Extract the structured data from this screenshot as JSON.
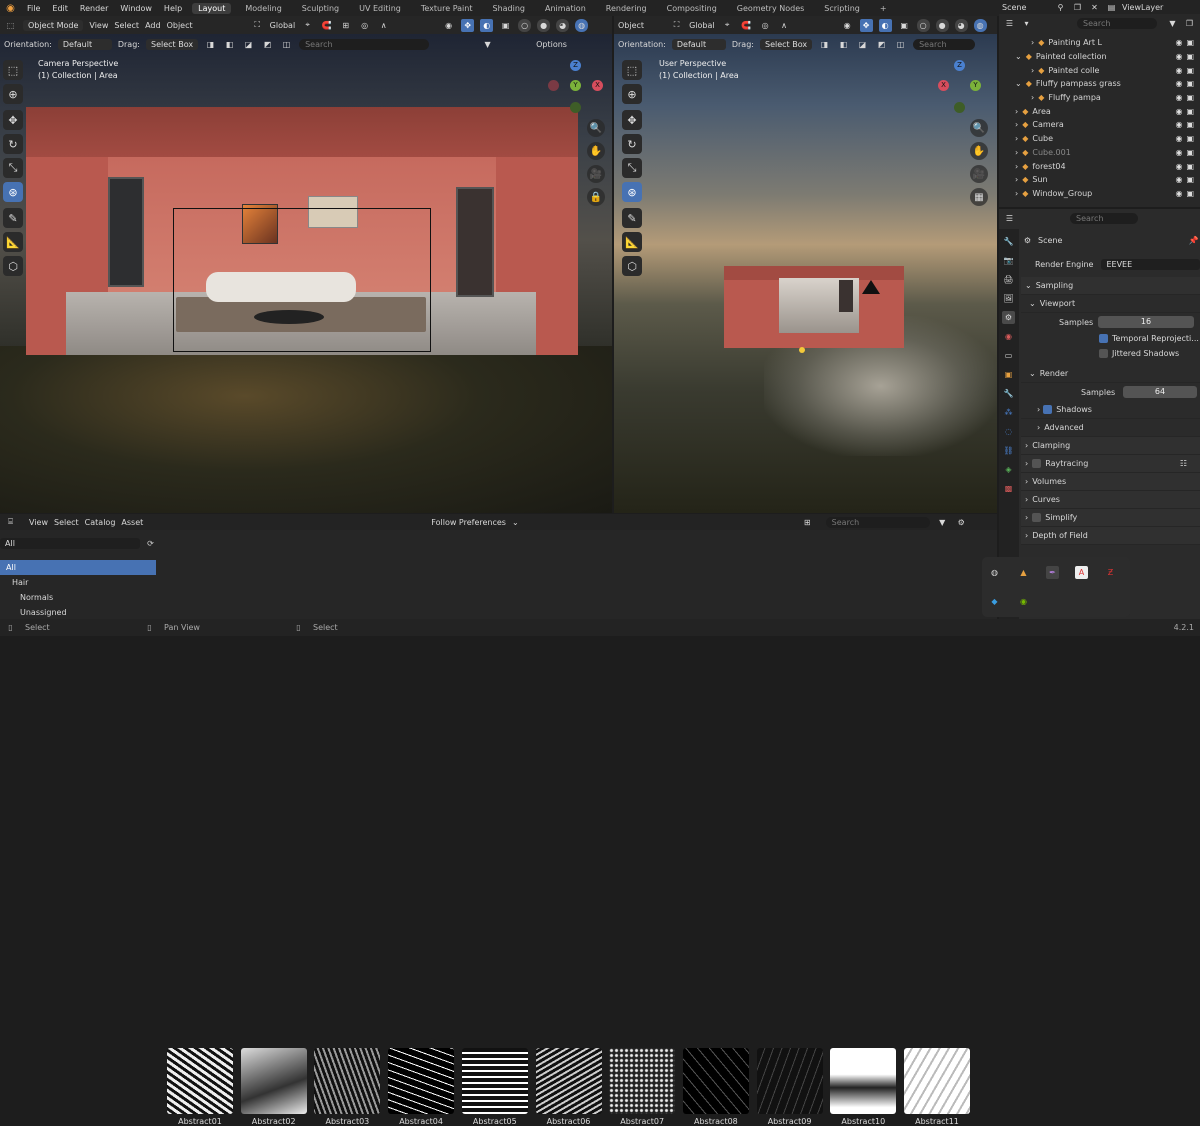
{
  "menu": [
    "File",
    "Edit",
    "Render",
    "Window",
    "Help"
  ],
  "workspaces": [
    "Layout",
    "Modeling",
    "Sculpting",
    "UV Editing",
    "Texture Paint",
    "Shading",
    "Animation",
    "Rendering",
    "Compositing",
    "Geometry Nodes",
    "Scripting"
  ],
  "workspace_add": "+",
  "scene": {
    "label": "Scene",
    "viewlayer": "ViewLayer"
  },
  "viewport_left": {
    "mode": "Object Mode",
    "menu": [
      "View",
      "Select",
      "Add",
      "Object"
    ],
    "transform_orientation": "Global",
    "orientation_label": "Orientation:",
    "orientation_value": "Default",
    "drag_label": "Drag:",
    "drag_value": "Select Box",
    "search_placeholder": "Search",
    "options_label": "Options",
    "perspective": "Camera Perspective",
    "collection": "(1) Collection | Area"
  },
  "viewport_right": {
    "mode": "Object",
    "transform_orientation": "Global",
    "orientation_label": "Orientation:",
    "orientation_value": "Default",
    "drag_label": "Drag:",
    "drag_value": "Select Box",
    "search_placeholder": "Search",
    "perspective": "User Perspective",
    "collection": "(1) Collection | Area"
  },
  "gizmo": {
    "x": "X",
    "y": "Y",
    "z": "Z"
  },
  "outliner": {
    "search_placeholder": "Search",
    "rows": [
      {
        "label": "Painting Art L",
        "indent": 2,
        "dim": false
      },
      {
        "label": "Painted collection",
        "indent": 0,
        "dim": false
      },
      {
        "label": "Painted colle",
        "indent": 2,
        "dim": false
      },
      {
        "label": "Fluffy pampass grass",
        "indent": 0,
        "dim": false
      },
      {
        "label": "Fluffy pampa",
        "indent": 2,
        "dim": false
      },
      {
        "label": "Area",
        "indent": 0,
        "dim": false
      },
      {
        "label": "Camera",
        "indent": 0,
        "dim": false
      },
      {
        "label": "Cube",
        "indent": 0,
        "dim": false
      },
      {
        "label": "Cube.001",
        "indent": 0,
        "dim": true
      },
      {
        "label": "forest04",
        "indent": 0,
        "dim": false
      },
      {
        "label": "Sun",
        "indent": 0,
        "dim": false
      },
      {
        "label": "Window_Group",
        "indent": 0,
        "dim": false
      }
    ]
  },
  "properties": {
    "search_placeholder": "Search",
    "scene_name": "Scene",
    "render_engine_label": "Render Engine",
    "render_engine_value": "EEVEE",
    "sampling": "Sampling",
    "viewport": "Viewport",
    "samples_label": "Samples",
    "viewport_samples": "16",
    "temporal_reprojection": "Temporal Reprojecti...",
    "jittered_shadows": "Jittered Shadows",
    "render": "Render",
    "render_samples": "64",
    "shadows": "Shadows",
    "advanced": "Advanced",
    "clamping": "Clamping",
    "raytracing": "Raytracing",
    "volumes": "Volumes",
    "curves": "Curves",
    "simplify": "Simplify",
    "depth_of_field": "Depth of Field"
  },
  "asset_browser": {
    "menu": [
      "View",
      "Select",
      "Catalog",
      "Asset"
    ],
    "import_method": "Follow Preferences",
    "library": "All",
    "search_placeholder": "Search",
    "catalogs": [
      {
        "label": "All",
        "selected": true
      },
      {
        "label": "Hair",
        "selected": false
      },
      {
        "label": "Normals",
        "selected": false
      },
      {
        "label": "Unassigned",
        "selected": false
      }
    ],
    "assets": [
      "Abstract01",
      "Abstract02",
      "Abstract03",
      "Abstract04",
      "Abstract05",
      "Abstract06",
      "Abstract07",
      "Abstract08",
      "Abstract09",
      "Abstract10",
      "Abstract11"
    ]
  },
  "status": {
    "left": "Select",
    "middle": "Pan View",
    "right": "Select",
    "version": "4.2.1"
  },
  "colors": {
    "accent": "#4772b3",
    "wall": "#b9594f",
    "panel": "#2a2a2a"
  }
}
